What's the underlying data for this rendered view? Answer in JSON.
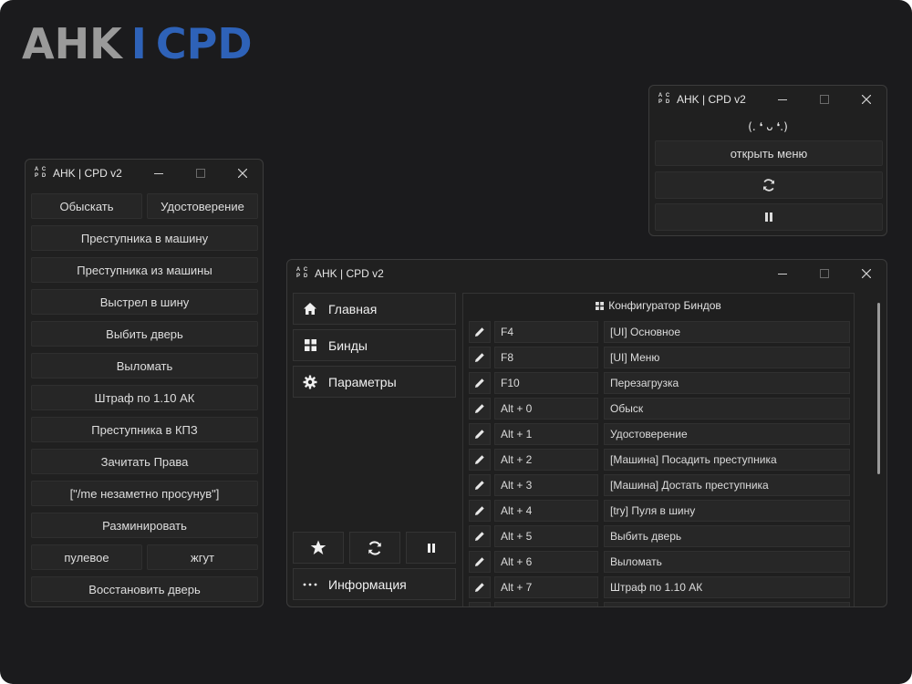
{
  "brand": {
    "part1": "AHK",
    "part2": "I",
    "part3": "CPD"
  },
  "app_icon_letters": [
    "A",
    "C",
    "P",
    "D"
  ],
  "small_window": {
    "title": "AHK | CPD v2",
    "emoticon": "(. ❛ ᴗ ❛.)",
    "open_menu_label": "открыть меню",
    "refresh_icon": "refresh-icon",
    "pause_icon": "pause-icon"
  },
  "left_window": {
    "title": "AHK | CPD v2",
    "buttons": {
      "search": "Обыскать",
      "id": "Удостоверение",
      "to_car": "Преступника в машину",
      "from_car": "Преступника из машины",
      "tire_shot": "Выстрел в шину",
      "knock_door": "Выбить дверь",
      "break_in": "Выломать",
      "fine": "Штраф по 1.10 АК",
      "to_kpz": "Преступника в КПЗ",
      "read_rights": "Зачитать Права",
      "me_text": "[\"/me незаметно просунув\"]",
      "demine": "Разминировать",
      "bullet": "пулевое",
      "tourniquet": "жгут",
      "restore_door": "Восстановить дверь"
    }
  },
  "main_window": {
    "title": "AHK | CPD v2",
    "nav": {
      "home": "Главная",
      "binds": "Бинды",
      "settings": "Параметры",
      "info": "Информация"
    },
    "panel_title": "Конфигуратор Биндов",
    "binds": [
      {
        "key": "F4",
        "action": "[UI] Основное"
      },
      {
        "key": "F8",
        "action": "[UI] Меню"
      },
      {
        "key": "F10",
        "action": "Перезагрузка"
      },
      {
        "key": "Alt + 0",
        "action": "Обыск"
      },
      {
        "key": "Alt + 1",
        "action": "Удостоверение"
      },
      {
        "key": "Alt + 2",
        "action": "[Машина] Посадить преступника"
      },
      {
        "key": "Alt + 3",
        "action": "[Машина] Достать преступника"
      },
      {
        "key": "Alt + 4",
        "action": "[try] Пуля в шину"
      },
      {
        "key": "Alt + 5",
        "action": "Выбить дверь"
      },
      {
        "key": "Alt + 6",
        "action": "Выломать"
      },
      {
        "key": "Alt + 7",
        "action": "Штраф по 1.10 АК"
      }
    ]
  },
  "colors": {
    "background": "#1b1b1d",
    "window": "#202020",
    "button": "#262626",
    "brand_gray": "#9a9a9a",
    "brand_blue": "#2e62b8"
  }
}
